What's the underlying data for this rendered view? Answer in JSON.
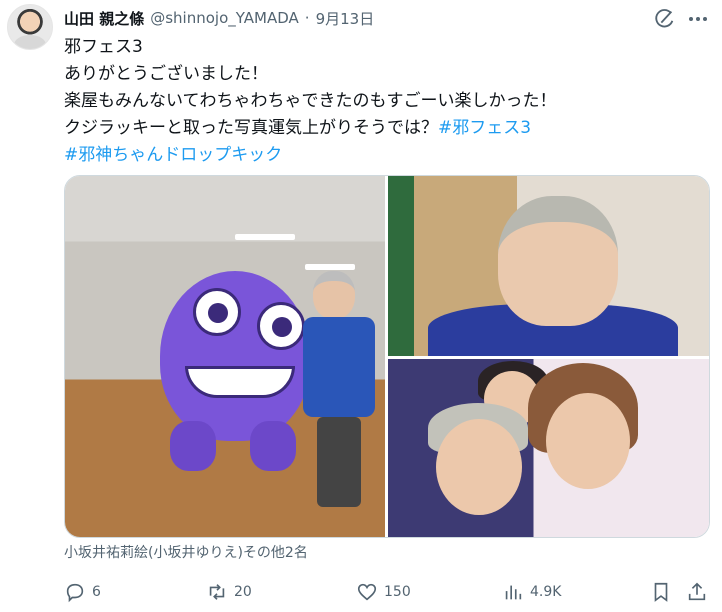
{
  "post": {
    "author_name": "山田 親之條",
    "author_handle": "@shinnojo_YAMADA",
    "separator": "·",
    "date": "9月13日",
    "lines": [
      "邪フェス3",
      "ありがとうございました！",
      "楽屋もみんないてわちゃわちゃできたのもすごーい楽しかった！",
      "クジラッキーと取った写真運気上がりそうでは？"
    ],
    "hashtag_1": "#邪フェス3",
    "hashtag_2": "#邪神ちゃんドロップキック",
    "media_caption": "小坂井祐莉絵(小坂井ゆりえ)その他2名"
  },
  "actions": {
    "replies": "6",
    "reposts": "20",
    "likes": "150",
    "views": "4.9K"
  },
  "icons": [
    "grok-icon",
    "more-icon",
    "reply-icon",
    "repost-icon",
    "like-icon",
    "views-icon",
    "bookmark-icon",
    "share-icon"
  ],
  "colors": {
    "text": "#0f1419",
    "secondary": "#536471",
    "accent": "#1d9bf0"
  }
}
